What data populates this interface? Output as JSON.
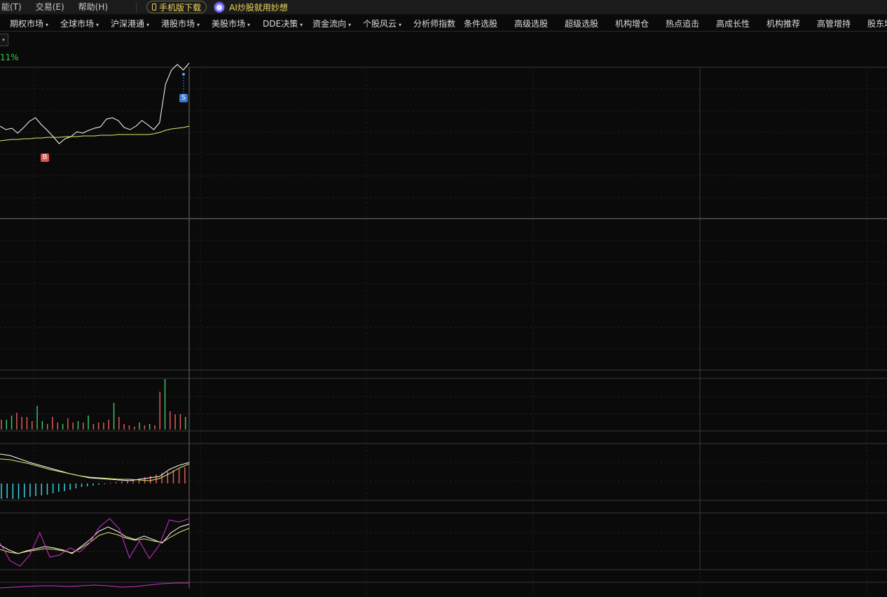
{
  "menubar": {
    "items": [
      "能(T)",
      "交易(E)",
      "帮助(H)"
    ],
    "download_label": "手机版下载",
    "ai_label": "AI炒股就用妙想"
  },
  "nav": {
    "tabs": [
      {
        "label": "期权市场",
        "dropdown": true
      },
      {
        "label": "全球市场",
        "dropdown": true
      },
      {
        "label": "沪深港通",
        "dropdown": true
      },
      {
        "label": "港股市场",
        "dropdown": true
      },
      {
        "label": "美股市场",
        "dropdown": true
      },
      {
        "label": "DDE决策",
        "dropdown": true
      },
      {
        "label": "资金流向",
        "dropdown": true
      },
      {
        "label": "个股风云",
        "dropdown": true
      },
      {
        "label": "分析师指数",
        "dropdown": false
      },
      {
        "label": "条件选股",
        "dropdown": false
      },
      {
        "label": "高级选股",
        "dropdown": false
      },
      {
        "label": "超级选股",
        "dropdown": false
      },
      {
        "label": "机构增仓",
        "dropdown": false
      },
      {
        "label": "热点追击",
        "dropdown": false
      },
      {
        "label": "高成长性",
        "dropdown": false
      },
      {
        "label": "机构推荐",
        "dropdown": false
      },
      {
        "label": "高管增持",
        "dropdown": false
      },
      {
        "label": "股东增",
        "dropdown": false
      }
    ]
  },
  "chart_header": {
    "percent": "11%"
  },
  "markers": {
    "sell": "S",
    "buy": "B"
  },
  "colors": {
    "price_line": "#ffffff",
    "ma_line": "#e8e870",
    "vol_up": "#e05a5a",
    "vol_down": "#3cc26b",
    "macd_neg": "#3ad0e0",
    "kdj_j": "#cc33cc",
    "grid": "#2a2a2a"
  },
  "chart_data": {
    "type": "line",
    "price": [
      180,
      185,
      183,
      190,
      182,
      173,
      168,
      178,
      186,
      195,
      205,
      198,
      195,
      188,
      190,
      186,
      183,
      181,
      170,
      168,
      172,
      182,
      185,
      180,
      172,
      178,
      185,
      175,
      120,
      100,
      92,
      100,
      90
    ],
    "ma": [
      201,
      200,
      199,
      199,
      198,
      198,
      197,
      197,
      196,
      196,
      196,
      195,
      195,
      195,
      194,
      194,
      194,
      193,
      193,
      193,
      192,
      192,
      192,
      192,
      192,
      192,
      191,
      189,
      186,
      184,
      183,
      182,
      180
    ],
    "volume": [
      14,
      14,
      20,
      24,
      18,
      18,
      12,
      34,
      12,
      8,
      18,
      10,
      8,
      16,
      10,
      12,
      10,
      20,
      8,
      10,
      10,
      14,
      38,
      18,
      8,
      6,
      4,
      10,
      6,
      8,
      6,
      54,
      72,
      26,
      22,
      22,
      18
    ],
    "macd_dif": [
      648,
      650,
      655,
      660,
      664,
      668,
      672,
      676,
      679,
      682,
      683,
      684,
      685,
      686,
      684,
      682,
      680,
      670,
      664,
      660
    ],
    "macd_dea": [
      655,
      656,
      659,
      662,
      666,
      670,
      673,
      676,
      679,
      681,
      682,
      683,
      684,
      684,
      685,
      686,
      683,
      676,
      668,
      662
    ],
    "macd_hist": [
      -22,
      -21,
      -22,
      -22,
      -20,
      -19,
      -18,
      -17,
      -16,
      -14,
      -12,
      -11,
      -9,
      -7,
      -5,
      -4,
      -3,
      -2,
      -1,
      1,
      2,
      3,
      4,
      5,
      7,
      9,
      11,
      13,
      15,
      17,
      19,
      21,
      23
    ],
    "kdj_k": [
      778,
      785,
      790,
      786,
      783,
      780,
      782,
      785,
      790,
      780,
      770,
      758,
      752,
      758,
      766,
      770,
      765,
      770,
      775,
      760,
      752,
      748
    ],
    "kdj_d": [
      784,
      788,
      790,
      787,
      785,
      783,
      784,
      786,
      789,
      782,
      774,
      764,
      760,
      763,
      768,
      771,
      769,
      772,
      774,
      766,
      759,
      754
    ],
    "kdj_j": [
      775,
      800,
      808,
      792,
      760,
      795,
      792,
      782,
      788,
      775,
      752,
      740,
      755,
      796,
      772,
      797,
      778,
      742,
      745,
      740
    ],
    "bottom_line": [
      839,
      838,
      837,
      836,
      836,
      837,
      836,
      835,
      836,
      838,
      837,
      835,
      833,
      832,
      832
    ]
  }
}
